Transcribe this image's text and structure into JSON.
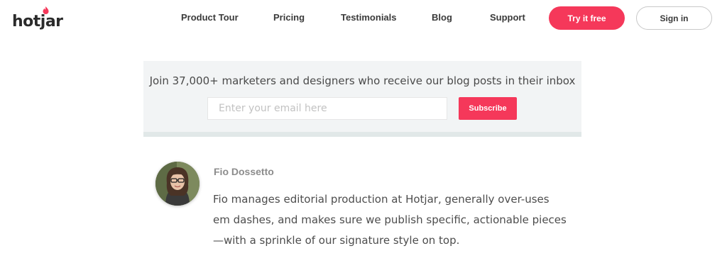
{
  "header": {
    "logo_text": "hotjar",
    "nav": [
      {
        "label": "Product Tour"
      },
      {
        "label": "Pricing"
      },
      {
        "label": "Testimonials"
      },
      {
        "label": "Blog"
      },
      {
        "label": "Support"
      }
    ],
    "try_label": "Try it free",
    "signin_label": "Sign in"
  },
  "newsletter": {
    "text": "Join 37,000+ marketers and designers who receive our blog posts in their inbox",
    "email_placeholder": "Enter your email here",
    "subscribe_label": "Subscribe"
  },
  "author": {
    "name": "Fio Dossetto",
    "bio": "Fio manages editorial production at Hotjar, generally over-uses em dashes, and makes sure we publish specific, actionable pieces—with a sprinkle of our signature style on top."
  },
  "colors": {
    "accent": "#f5385a",
    "newsletter_bg": "#f2f4f5"
  }
}
